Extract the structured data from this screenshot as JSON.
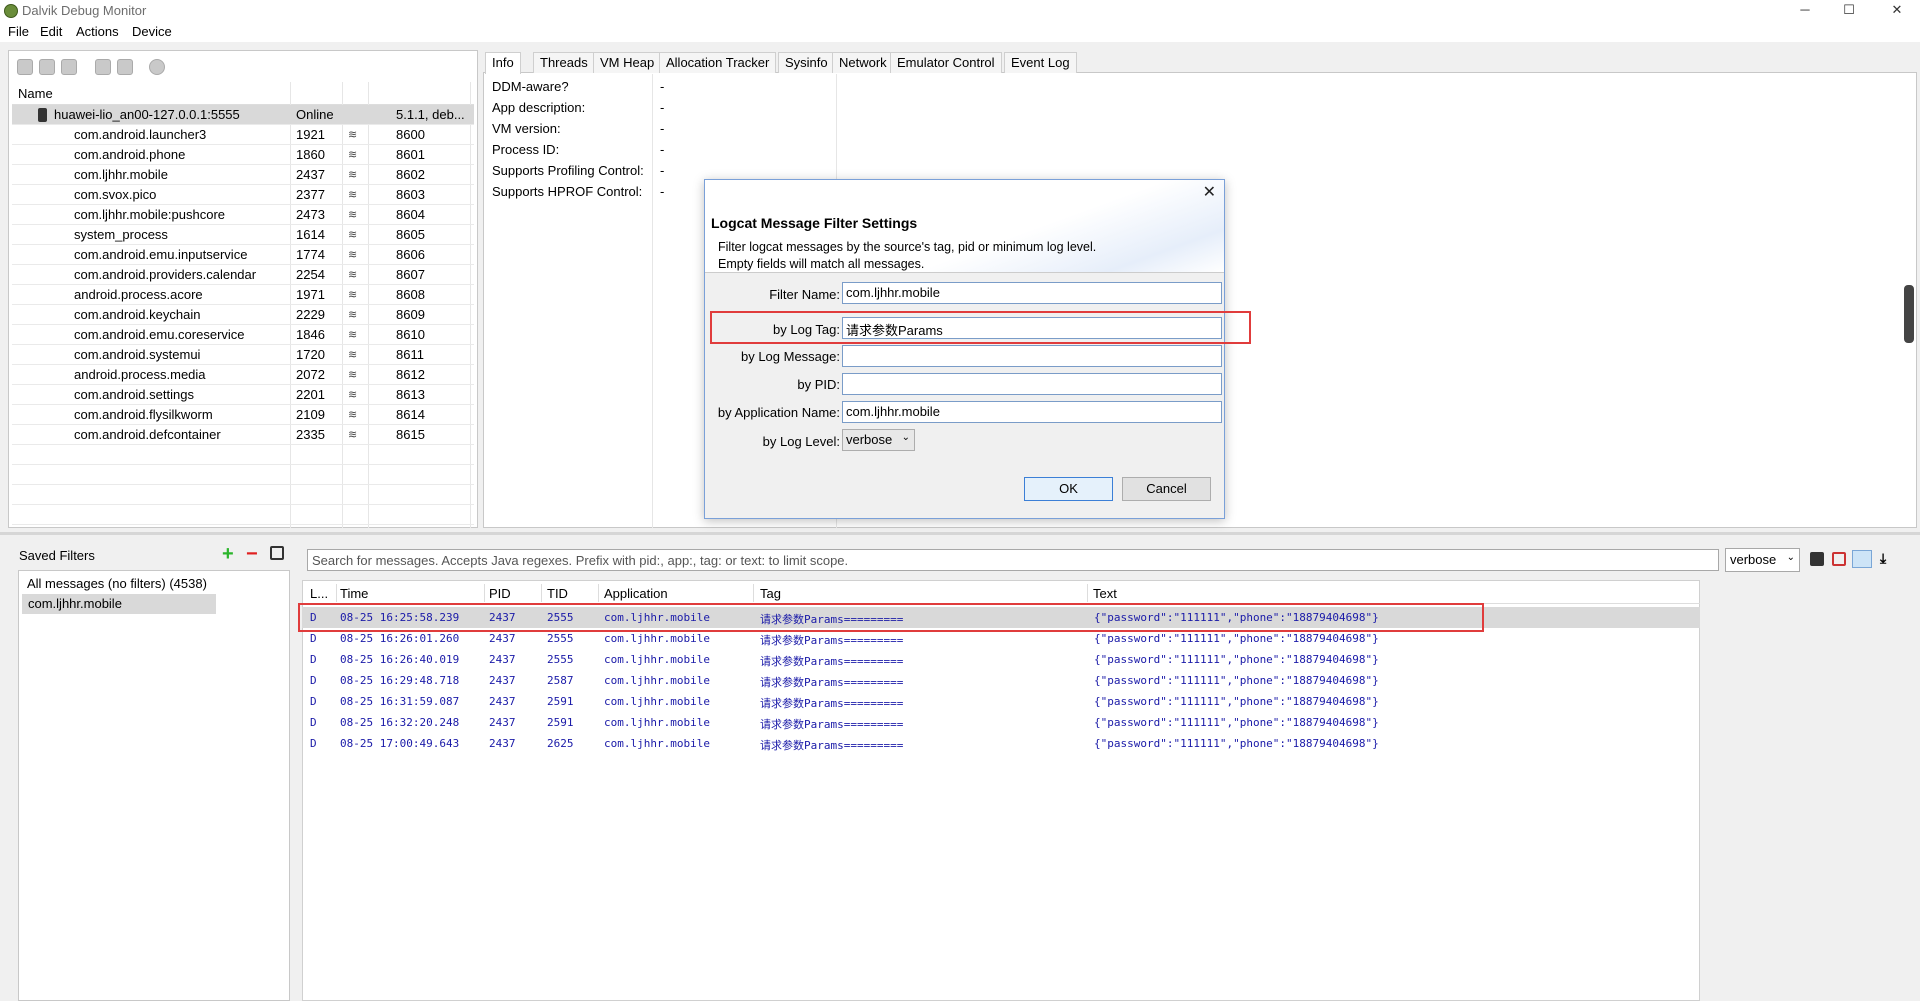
{
  "window": {
    "title": "Dalvik Debug Monitor",
    "controls": {
      "minimize": "─",
      "maximize": "☐",
      "close": "✕"
    }
  },
  "menu": [
    "File",
    "Edit",
    "Actions",
    "Device"
  ],
  "devices": {
    "header": {
      "name": "Name"
    },
    "device": {
      "name": "huawei-lio_an00-127.0.0.1:5555",
      "state": "Online",
      "version": "5.1.1, deb..."
    },
    "processes": [
      {
        "name": "com.android.launcher3",
        "pid": "1921",
        "port": "8600"
      },
      {
        "name": "com.android.phone",
        "pid": "1860",
        "port": "8601"
      },
      {
        "name": "com.ljhhr.mobile",
        "pid": "2437",
        "port": "8602"
      },
      {
        "name": "com.svox.pico",
        "pid": "2377",
        "port": "8603"
      },
      {
        "name": "com.ljhhr.mobile:pushcore",
        "pid": "2473",
        "port": "8604"
      },
      {
        "name": "system_process",
        "pid": "1614",
        "port": "8605"
      },
      {
        "name": "com.android.emu.inputservice",
        "pid": "1774",
        "port": "8606"
      },
      {
        "name": "com.android.providers.calendar",
        "pid": "2254",
        "port": "8607"
      },
      {
        "name": "android.process.acore",
        "pid": "1971",
        "port": "8608"
      },
      {
        "name": "com.android.keychain",
        "pid": "2229",
        "port": "8609"
      },
      {
        "name": "com.android.emu.coreservice",
        "pid": "1846",
        "port": "8610"
      },
      {
        "name": "com.android.systemui",
        "pid": "1720",
        "port": "8611"
      },
      {
        "name": "android.process.media",
        "pid": "2072",
        "port": "8612"
      },
      {
        "name": "com.android.settings",
        "pid": "2201",
        "port": "8613"
      },
      {
        "name": "com.android.flysilkworm",
        "pid": "2109",
        "port": "8614"
      },
      {
        "name": "com.android.defcontainer",
        "pid": "2335",
        "port": "8615"
      }
    ]
  },
  "tabs": [
    "Info",
    "Threads",
    "VM Heap",
    "Allocation Tracker",
    "Sysinfo",
    "Network",
    "Emulator Control",
    "Event Log"
  ],
  "info": [
    {
      "label": "DDM-aware?",
      "value": "-"
    },
    {
      "label": "App description:",
      "value": "-"
    },
    {
      "label": "VM version:",
      "value": "-"
    },
    {
      "label": "Process ID:",
      "value": "-"
    },
    {
      "label": "Supports Profiling Control:",
      "value": "-"
    },
    {
      "label": "Supports HPROF Control:",
      "value": "-"
    }
  ],
  "dialog": {
    "title": "Logcat Message Filter Settings",
    "description_line1": "Filter logcat messages by the source's tag, pid or minimum log level.",
    "description_line2": "Empty fields will match all messages.",
    "fields": {
      "filter_name": {
        "label": "Filter Name:",
        "value": "com.ljhhr.mobile"
      },
      "log_tag": {
        "label": "by Log Tag:",
        "value": "请求参数Params"
      },
      "log_message": {
        "label": "by Log Message:",
        "value": ""
      },
      "pid": {
        "label": "by PID:",
        "value": ""
      },
      "app_name": {
        "label": "by Application Name:",
        "value": "com.ljhhr.mobile"
      },
      "log_level": {
        "label": "by Log Level:",
        "value": "verbose"
      }
    },
    "ok": "OK",
    "cancel": "Cancel"
  },
  "saved_filters": {
    "title": "Saved Filters",
    "items": [
      "All messages (no filters) (4538)",
      "com.ljhhr.mobile"
    ]
  },
  "logcat": {
    "search_placeholder": "Search for messages. Accepts Java regexes. Prefix with pid:, app:, tag: or text: to limit scope.",
    "level": "verbose",
    "columns": {
      "level": "L...",
      "time": "Time",
      "pid": "PID",
      "tid": "TID",
      "app": "Application",
      "tag": "Tag",
      "text": "Text"
    },
    "rows": [
      {
        "level": "D",
        "time": "08-25 16:25:58.239",
        "pid": "2437",
        "tid": "2555",
        "app": "com.ljhhr.mobile",
        "tag": "请求参数Params=========",
        "text": "{\"password\":\"111111\",\"phone\":\"18879404698\"}"
      },
      {
        "level": "D",
        "time": "08-25 16:26:01.260",
        "pid": "2437",
        "tid": "2555",
        "app": "com.ljhhr.mobile",
        "tag": "请求参数Params=========",
        "text": "{\"password\":\"111111\",\"phone\":\"18879404698\"}"
      },
      {
        "level": "D",
        "time": "08-25 16:26:40.019",
        "pid": "2437",
        "tid": "2555",
        "app": "com.ljhhr.mobile",
        "tag": "请求参数Params=========",
        "text": "{\"password\":\"111111\",\"phone\":\"18879404698\"}"
      },
      {
        "level": "D",
        "time": "08-25 16:29:48.718",
        "pid": "2437",
        "tid": "2587",
        "app": "com.ljhhr.mobile",
        "tag": "请求参数Params=========",
        "text": "{\"password\":\"111111\",\"phone\":\"18879404698\"}"
      },
      {
        "level": "D",
        "time": "08-25 16:31:59.087",
        "pid": "2437",
        "tid": "2591",
        "app": "com.ljhhr.mobile",
        "tag": "请求参数Params=========",
        "text": "{\"password\":\"111111\",\"phone\":\"18879404698\"}"
      },
      {
        "level": "D",
        "time": "08-25 16:32:20.248",
        "pid": "2437",
        "tid": "2591",
        "app": "com.ljhhr.mobile",
        "tag": "请求参数Params=========",
        "text": "{\"password\":\"111111\",\"phone\":\"18879404698\"}"
      },
      {
        "level": "D",
        "time": "08-25 17:00:49.643",
        "pid": "2437",
        "tid": "2625",
        "app": "com.ljhhr.mobile",
        "tag": "请求参数Params=========",
        "text": "{\"password\":\"111111\",\"phone\":\"18879404698\"}"
      }
    ]
  },
  "colors": {
    "highlight": "#e03c3c",
    "log_text": "#1a1aa8",
    "selection": "#d9d9d9"
  }
}
